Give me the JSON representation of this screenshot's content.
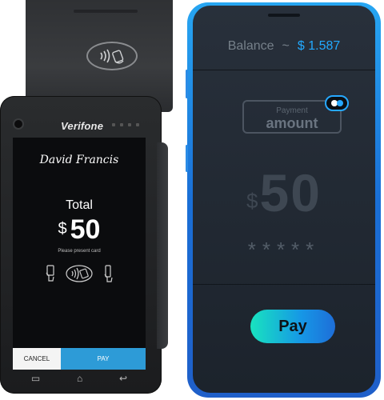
{
  "terminal": {
    "brand": "Verifone",
    "cardholder_name": "David Francis",
    "total_label": "Total",
    "currency_symbol": "$",
    "amount": "50",
    "instruction": "Please present card",
    "cancel_label": "CANCEL",
    "pay_label": "PAY",
    "payment_icons": [
      "insert-card-icon",
      "contactless-icon",
      "swipe-card-icon"
    ],
    "nav_icons": [
      "menu-icon",
      "home-icon",
      "back-icon"
    ]
  },
  "phone": {
    "balance_label": "Balance",
    "balance_separator": "~",
    "balance_value": "$ 1.587",
    "payment_label": "Payment",
    "amount_label": "amount",
    "currency_symbol": "$",
    "amount": "50",
    "pin_mask": "*****",
    "pay_label": "Pay"
  },
  "colors": {
    "terminal_pay": "#2d9bd7",
    "phone_accent": "#22a9ff",
    "phone_frame": "#1f6fd8",
    "pay_gradient_start": "#18e3bf",
    "pay_gradient_end": "#1e6ed8"
  }
}
